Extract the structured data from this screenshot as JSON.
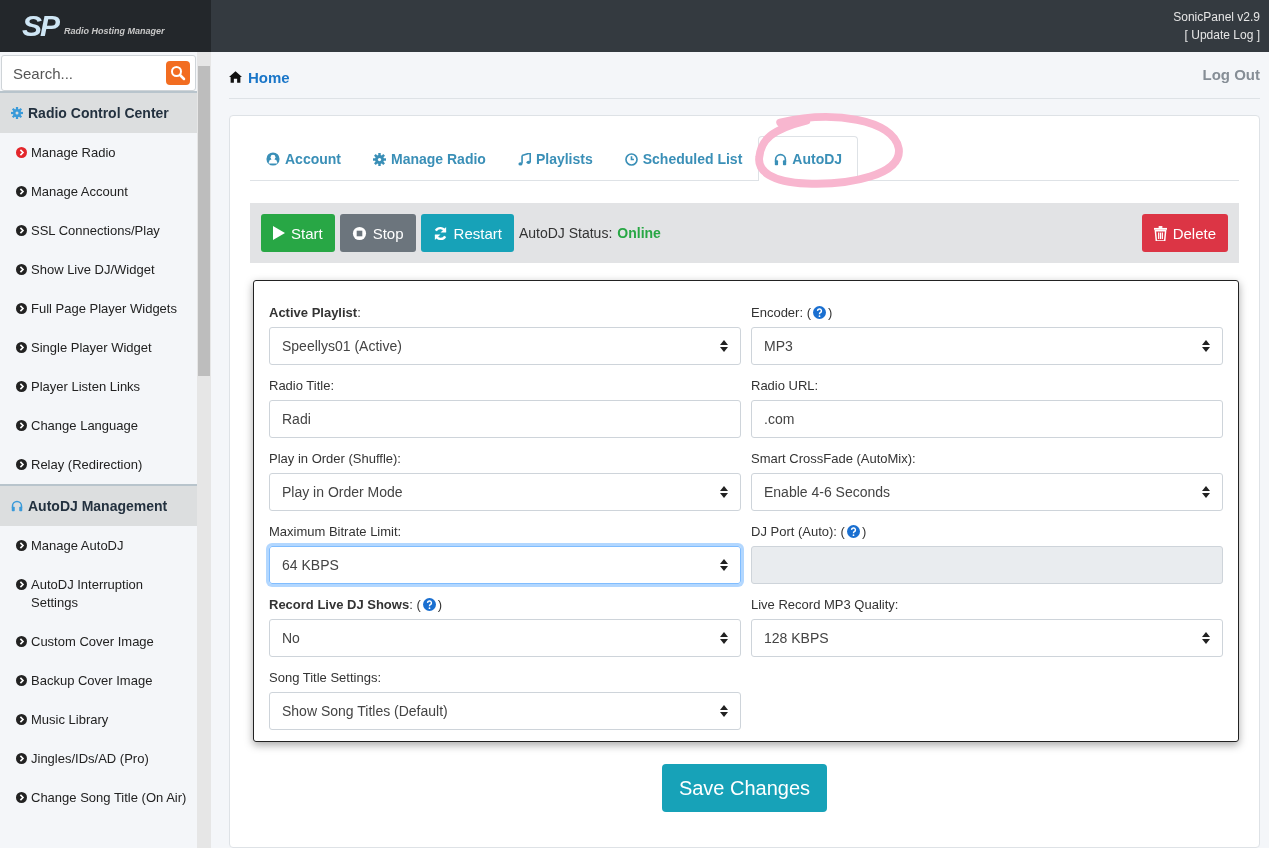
{
  "header": {
    "logo": {
      "mark": "SP",
      "tagline": "Radio Hosting Manager"
    },
    "version": "SonicPanel v2.9",
    "update_link": "[ Update Log ]"
  },
  "sidebar": {
    "search": {
      "placeholder": "Search..."
    },
    "sections": [
      {
        "title": "Radio Control Center",
        "items": [
          {
            "label": "Manage Radio",
            "selected": true
          },
          {
            "label": "Manage Account",
            "selected": false
          },
          {
            "label": "SSL Connections/Play",
            "selected": false
          },
          {
            "label": "Show Live DJ/Widget",
            "selected": false
          },
          {
            "label": "Full Page Player Widgets",
            "selected": false
          },
          {
            "label": "Single Player Widget",
            "selected": false
          },
          {
            "label": "Player Listen Links",
            "selected": false
          },
          {
            "label": "Change Language",
            "selected": false
          },
          {
            "label": "Relay (Redirection)",
            "selected": false
          }
        ]
      },
      {
        "title": "AutoDJ Management",
        "items": [
          {
            "label": "Manage AutoDJ",
            "selected": false
          },
          {
            "label": "AutoDJ Interruption Settings",
            "selected": false
          },
          {
            "label": "Custom Cover Image",
            "selected": false
          },
          {
            "label": "Backup Cover Image",
            "selected": false
          },
          {
            "label": "Music Library",
            "selected": false
          },
          {
            "label": "Jingles/IDs/AD (Pro)",
            "selected": false
          },
          {
            "label": "Change Song Title (On Air)",
            "selected": false
          }
        ]
      }
    ]
  },
  "breadcrumb": "Home",
  "logout": "Log Out",
  "tabs": [
    {
      "label": "Account",
      "selected": false
    },
    {
      "label": "Manage Radio",
      "selected": false
    },
    {
      "label": "Playlists",
      "selected": false
    },
    {
      "label": "Scheduled List",
      "selected": false
    },
    {
      "label": "AutoDJ",
      "selected": true
    }
  ],
  "toolbar": {
    "buttons": [
      {
        "label": "Start",
        "kind": "start"
      },
      {
        "label": "Stop",
        "kind": "stop"
      },
      {
        "label": "Restart",
        "kind": "restart"
      }
    ],
    "status_label": "AutoDJ Status:",
    "status": "Online",
    "delete": "Delete"
  },
  "fields": [
    {
      "label": "**Active Playlist**:",
      "kind": "select",
      "value": "Speellys01 (Active)",
      "focused": false
    },
    {
      "label": "Encoder: (",
      "help": true,
      "label_after": ")",
      "kind": "select",
      "value": "MP3",
      "focused": false
    },
    {
      "label": "Radio Title:",
      "kind": "input",
      "value": "Radi",
      "focused": false
    },
    {
      "label": "Radio URL:",
      "kind": "input",
      "value": ".com",
      "focused": false
    },
    {
      "label": "Play in Order (Shuffle):",
      "kind": "select",
      "value": "Play in Order Mode",
      "focused": false
    },
    {
      "label": "Smart CrossFade (AutoMix):",
      "kind": "select",
      "value": "Enable 4-6 Seconds",
      "focused": false
    },
    {
      "label": "Maximum Bitrate Limit:",
      "kind": "select",
      "value": "64 KBPS",
      "focused": true
    },
    {
      "label": "DJ Port (Auto): (",
      "help": true,
      "label_after": ")",
      "kind": "readonly",
      "focused": false
    },
    {
      "label": "**Record Live DJ Shows**: (",
      "help": true,
      "label_after": ")",
      "kind": "select",
      "value": "No",
      "focused": false
    },
    {
      "label": "Live Record MP3 Quality:",
      "kind": "select",
      "value": "128 KBPS",
      "focused": false
    },
    {
      "label": "Song Title Settings:",
      "kind": "select",
      "value": "Show Song Titles (Default)",
      "focused": false
    }
  ],
  "save": "Save Changes"
}
